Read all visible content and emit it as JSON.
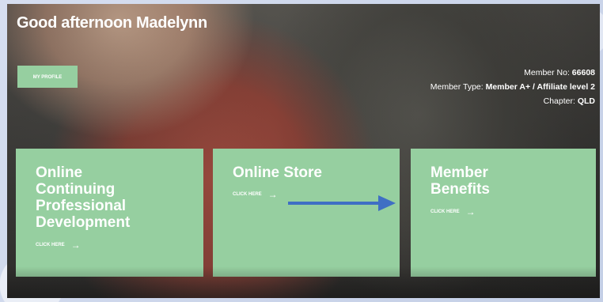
{
  "hero": {
    "greeting": "Good afternoon Madelynn",
    "profile_button": "MY PROFILE"
  },
  "member": {
    "no_label": "Member No:",
    "no_value": "66608",
    "type_label": "Member Type:",
    "type_value": "Member A+ / Affiliate level 2",
    "chapter_label": "Chapter:",
    "chapter_value": "QLD"
  },
  "tiles": [
    {
      "title_lines": [
        "Online",
        "Continuing",
        "Professional",
        "Development"
      ],
      "cta": "CLICK HERE",
      "arrow": "→"
    },
    {
      "title_lines": [
        "Online Store"
      ],
      "cta": "CLICK HERE",
      "arrow": "→"
    },
    {
      "title_lines": [
        "Member",
        "Benefits"
      ],
      "cta": "CLICK HERE",
      "arrow": "→"
    }
  ],
  "colors": {
    "tile": "#96cfa0",
    "annotation_arrow": "#3f6fc4"
  }
}
